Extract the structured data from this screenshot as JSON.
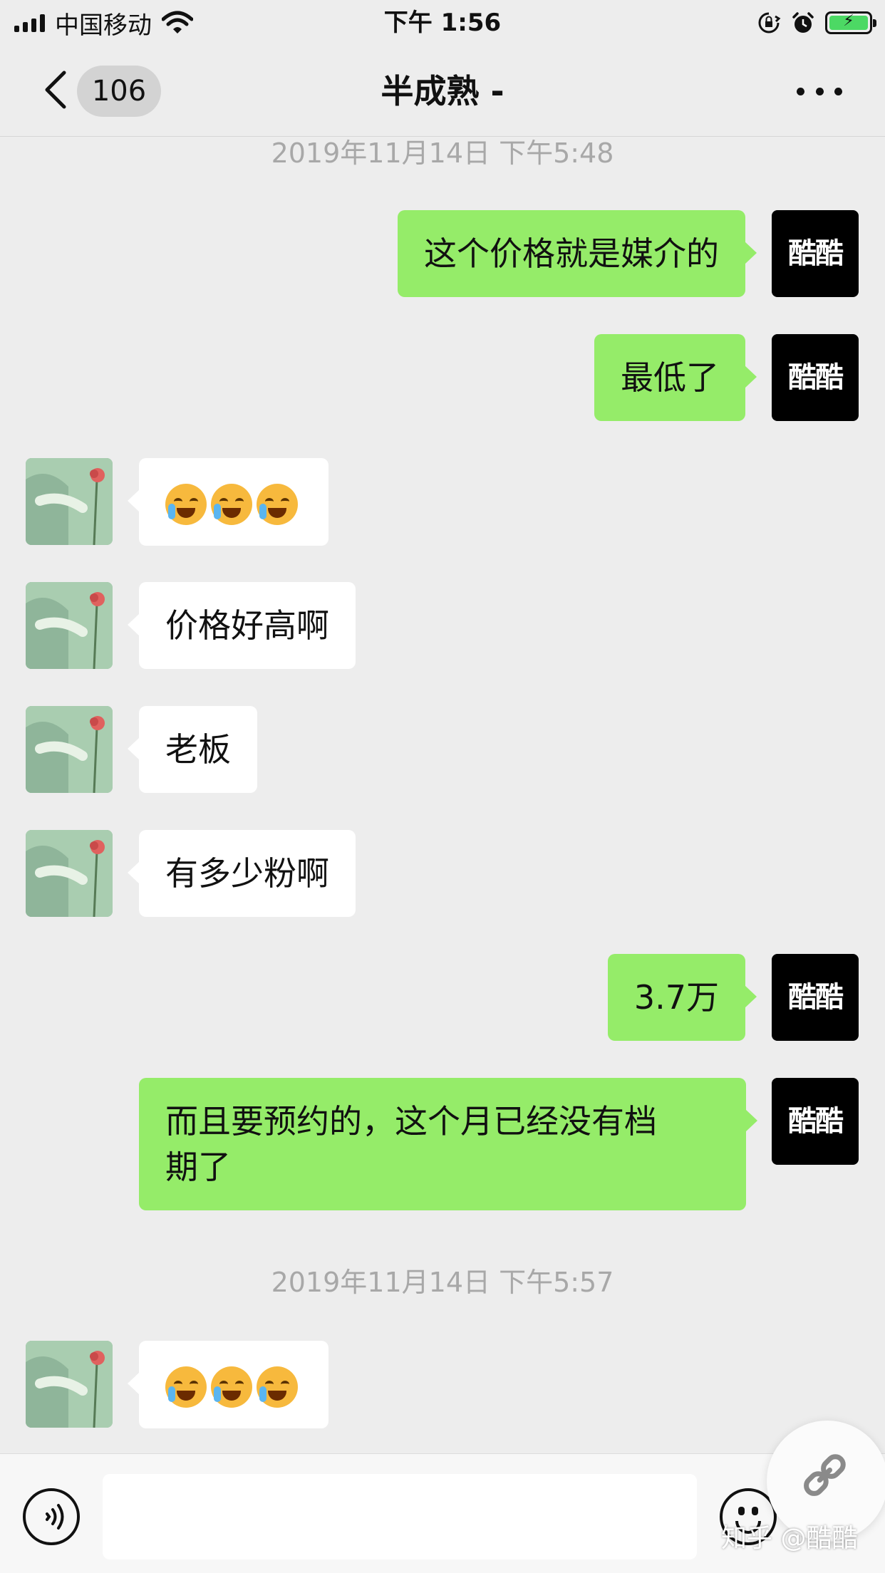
{
  "status_bar": {
    "carrier": "中国移动",
    "time": "下午 1:56",
    "icons": [
      "signal-icon",
      "wifi-icon",
      "rotation-lock-icon",
      "alarm-icon",
      "battery-charging-icon"
    ]
  },
  "nav": {
    "unread_count": "106",
    "title": "半成熟 -",
    "icons": [
      "back-chevron-icon",
      "more-dots-icon"
    ]
  },
  "messages": [
    {
      "type": "timestamp",
      "text": "2019年11月14日 下午5:48"
    },
    {
      "type": "text",
      "sender": "me",
      "avatar_text": "酷酷",
      "text": "这个价格就是媒介的"
    },
    {
      "type": "text",
      "sender": "me",
      "avatar_text": "酷酷",
      "text": "最低了"
    },
    {
      "type": "emoji",
      "sender": "other",
      "emoji": [
        "face-with-tears-icon",
        "face-with-tears-icon",
        "face-with-tears-icon"
      ]
    },
    {
      "type": "text",
      "sender": "other",
      "text": "价格好高啊"
    },
    {
      "type": "text",
      "sender": "other",
      "text": "老板"
    },
    {
      "type": "text",
      "sender": "other",
      "text": "有多少粉啊"
    },
    {
      "type": "text",
      "sender": "me",
      "avatar_text": "酷酷",
      "text": "3.7万"
    },
    {
      "type": "text",
      "sender": "me",
      "avatar_text": "酷酷",
      "text_line1": "而且要预约的，这个月已经没有档",
      "text_line2": "期了"
    },
    {
      "type": "timestamp",
      "text": "2019年11月14日 下午5:57"
    },
    {
      "type": "emoji",
      "sender": "other",
      "emoji": [
        "face-with-tears-icon",
        "face-with-tears-icon",
        "face-with-tears-icon"
      ]
    }
  ],
  "input_bar": {
    "text_value": "",
    "icons": [
      "voice-icon",
      "emoji-smile-icon",
      "link-icon"
    ]
  },
  "watermark": "知乎 @酷酷",
  "colors": {
    "background": "#ededed",
    "my_bubble": "#95ec69",
    "other_bubble": "#ffffff",
    "timestamp_text": "#a8a8a8",
    "battery": "#4cd964"
  }
}
